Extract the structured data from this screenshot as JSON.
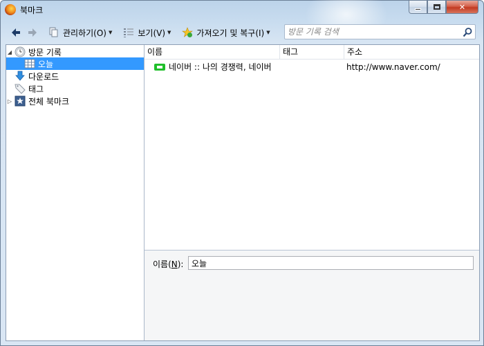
{
  "window": {
    "title": "북마크"
  },
  "toolbar": {
    "manage": "관리하기(O)",
    "views": "보기(V)",
    "import_backup": "가져오기 및 복구(I)",
    "search_placeholder": "방문 기록 검색"
  },
  "sidebar": {
    "items": [
      {
        "label": "방문 기록",
        "icon": "clock-icon",
        "expanded": true
      },
      {
        "label": "오늘",
        "icon": "calendar-grid-icon",
        "selected": true
      },
      {
        "label": "다운로드",
        "icon": "download-arrow-icon"
      },
      {
        "label": "태그",
        "icon": "tag-icon"
      },
      {
        "label": "전체 북마크",
        "icon": "star-folder-icon",
        "expanded": false
      }
    ]
  },
  "list": {
    "columns": [
      "이름",
      "태그",
      "주소"
    ],
    "rows": [
      {
        "name": "네이버 :: 나의 경쟁력, 네이버",
        "tags": "",
        "url": "http://www.naver.com/",
        "icon": "naver-favicon"
      }
    ]
  },
  "details": {
    "name_label": "이름(N):",
    "name_value": "오늘"
  },
  "colors": {
    "selection": "#3399ff",
    "accent_green": "#1fbf2a"
  }
}
